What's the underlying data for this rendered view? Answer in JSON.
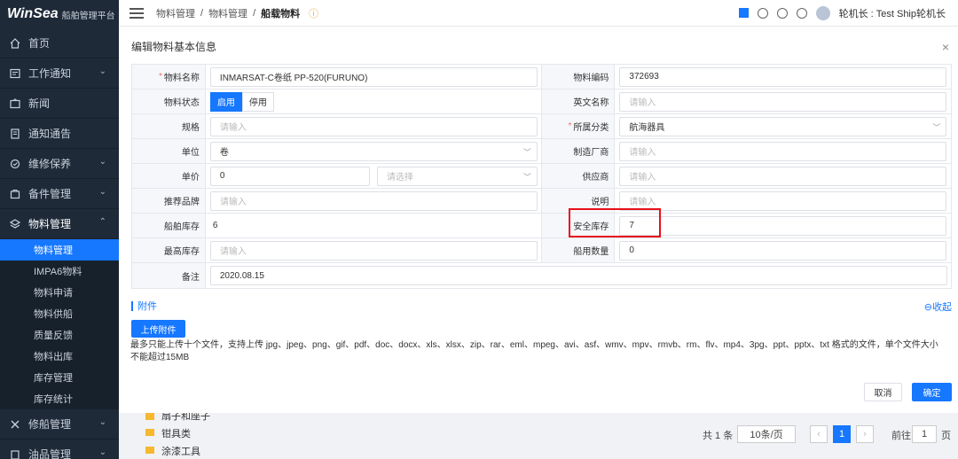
{
  "app": {
    "logo": "WinSea",
    "logo_sub": "船舶管理平台"
  },
  "sidebar": {
    "items": [
      {
        "label": "首页",
        "icon": "home-icon"
      },
      {
        "label": "工作通知",
        "icon": "message-icon",
        "chevron": "⌄"
      },
      {
        "label": "新闻",
        "icon": "news-icon"
      },
      {
        "label": "通知通告",
        "icon": "notice-icon"
      },
      {
        "label": "维修保养",
        "icon": "maintenance-icon",
        "chevron": "⌄"
      },
      {
        "label": "备件管理",
        "icon": "spare-parts-icon",
        "chevron": "⌄"
      },
      {
        "label": "物料管理",
        "icon": "layers-icon",
        "chevron": "⌃"
      }
    ],
    "sub_items": [
      "物料管理",
      "IMPA6物料",
      "物料申请",
      "物料供船",
      "质量反馈",
      "物料出库",
      "库存管理",
      "库存统计"
    ],
    "bottom_items": [
      {
        "label": "修船管理",
        "icon": "tools-icon",
        "chevron": "⌄"
      },
      {
        "label": "油品管理",
        "icon": "oil-icon",
        "chevron": "⌄"
      }
    ]
  },
  "header": {
    "crumbs": [
      "物料管理",
      "物料管理",
      "船载物料"
    ],
    "separator": "/",
    "user": "轮机长 : Test Ship轮机长"
  },
  "background": {
    "folders": [
      "扇子和座子",
      "钳具类",
      "涂漆工具"
    ],
    "pager": {
      "total": "共 1 条",
      "page_size": "10条/页",
      "current_page": "1",
      "goto_prefix": "前往",
      "goto_value": "1",
      "goto_suffix": "页"
    }
  },
  "modal": {
    "title": "编辑物料基本信息",
    "close": "×",
    "fields": {
      "name_label": "物料名称",
      "name_value": "INMARSAT-C卷纸 PP-520(FURUNO)",
      "code_label": "物料编码",
      "code_value": "372693",
      "status_label": "物料状态",
      "status_on": "启用",
      "status_off": "停用",
      "en_name_label": "英文名称",
      "en_name_placeholder": "请输入",
      "spec_label": "规格",
      "spec_placeholder": "请输入",
      "category_label": "所属分类",
      "category_value": "航海器具",
      "unit_label": "单位",
      "unit_value": "卷",
      "maker_label": "制造厂商",
      "maker_placeholder": "请输入",
      "price_label": "单价",
      "price_value": "0",
      "currency_placeholder": "请选择",
      "supplier_label": "供应商",
      "supplier_placeholder": "请输入",
      "brand_label": "推荐品牌",
      "brand_placeholder": "请输入",
      "desc_label": "说明",
      "desc_placeholder": "请输入",
      "stock_label": "船舶库存",
      "stock_value": "6",
      "safety_label": "安全库存",
      "safety_value": "7",
      "max_label": "最高库存",
      "max_placeholder": "请输入",
      "usage_label": "船用数量",
      "usage_value": "0",
      "remark_label": "备注",
      "remark_value": "2020.08.15"
    },
    "attachment": {
      "title": "附件",
      "collapse": "⊖收起",
      "upload_button": "上传附件",
      "hint": "最多只能上传十个文件，支持上传 jpg、jpeg、png、gif、pdf、doc、docx、xls、xlsx、zip、rar、eml、mpeg、avi、asf、wmv、mpv、rmvb、rm、flv、mp4、3pg、ppt、pptx、txt 格式的文件，单个文件大小不能超过15MB"
    },
    "buttons": {
      "cancel": "取消",
      "ok": "确定"
    }
  },
  "colors": {
    "primary": "#1677ff",
    "sidebar": "#1e2a38",
    "highlight": "#e8101a"
  }
}
